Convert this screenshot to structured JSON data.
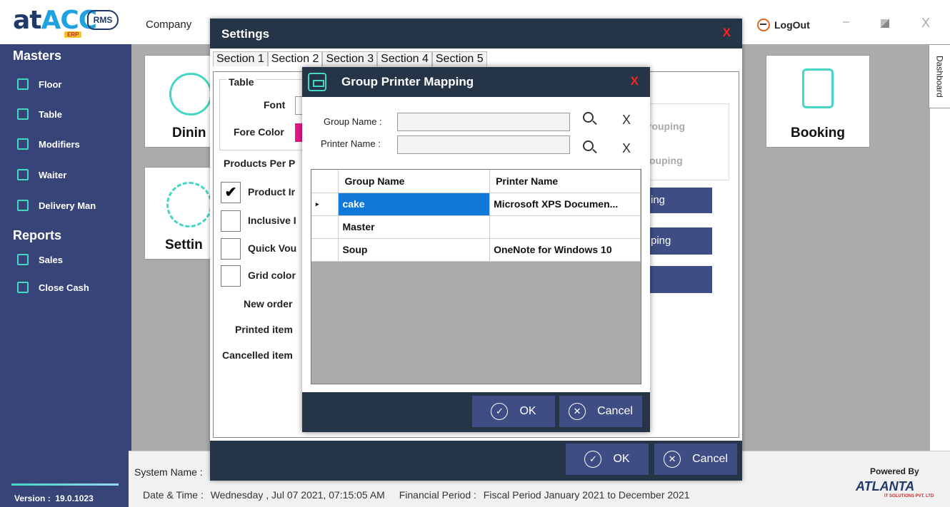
{
  "app": {
    "logo": {
      "part1": "at",
      "part2": "ACC",
      "erp": "ERP",
      "rms": "RMS"
    },
    "company_label": "Company",
    "logout_label": "LogOut",
    "window_min": "–",
    "window_close": "X"
  },
  "sidebar": {
    "masters_heading": "Masters",
    "masters": [
      {
        "label": "Floor",
        "icon": "floor-icon"
      },
      {
        "label": "Table",
        "icon": "table-icon"
      },
      {
        "label": "Modifiers",
        "icon": "modifiers-icon"
      },
      {
        "label": "Waiter",
        "icon": "waiter-icon"
      },
      {
        "label": "Delivery Man",
        "icon": "delivery-man-icon"
      }
    ],
    "reports_heading": "Reports",
    "reports": [
      {
        "label": "Sales",
        "icon": "sales-icon"
      },
      {
        "label": "Close Cash",
        "icon": "close-cash-icon"
      }
    ],
    "version_label": "Version :",
    "version_value": "19.0.1023"
  },
  "dashboard": {
    "tiles": {
      "dining": "Dinin",
      "settings": "Settin",
      "booking": "Booking"
    },
    "side_tab": "Dashboard"
  },
  "status": {
    "system_name_label": "System Name :",
    "datetime_label": "Date & Time :",
    "datetime_value": "Wednesday , Jul 07 2021, 07:15:05 AM",
    "fin_period_label": "Financial Period :",
    "fin_period_value": "Fiscal Period January 2021 to December 2021",
    "powered_by": "Powered By",
    "atlanta": "ATLANTA",
    "atlanta_sub": "IT SOLUTIONS PVT. LTD"
  },
  "settings": {
    "title": "Settings",
    "close": "X",
    "tabs": [
      "Section 1",
      "Section 2",
      "Section 3",
      "Section 4",
      "Section 5"
    ],
    "active_tab": "Section 2",
    "table_group": "Table",
    "font_label": "Font",
    "fore_color_label": "Fore Color",
    "fore_color": "#e8178a",
    "products_per": "Products Per P",
    "checks": [
      {
        "label": "Product Ir",
        "checked": true
      },
      {
        "label": "Inclusive I",
        "checked": false
      },
      {
        "label": "Quick Vou",
        "checked": false
      },
      {
        "label": "Grid color",
        "checked": false
      }
    ],
    "order_labels": [
      "New order",
      "Printed item",
      "Cancelled item"
    ],
    "grouping_1": "rouping",
    "grouping_2": "ouping",
    "right_btn_1": "ing",
    "right_btn_2": "ping",
    "ok": "OK",
    "cancel": "Cancel"
  },
  "gpm": {
    "title": "Group Printer Mapping",
    "close": "X",
    "group_name_label": "Group Name :",
    "group_name_value": "",
    "printer_name_label": "Printer Name :",
    "printer_name_value": "",
    "clear": "X",
    "columns": [
      "Group Name",
      "Printer Name"
    ],
    "rows": [
      {
        "indicator": "▸",
        "group": "cake",
        "printer": "Microsoft XPS Documen...",
        "selected": true
      },
      {
        "indicator": "",
        "group": "Master",
        "printer": "",
        "selected": false
      },
      {
        "indicator": "",
        "group": "Soup",
        "printer": "OneNote for Windows 10",
        "selected": false
      }
    ],
    "ok": "OK",
    "cancel": "Cancel"
  }
}
